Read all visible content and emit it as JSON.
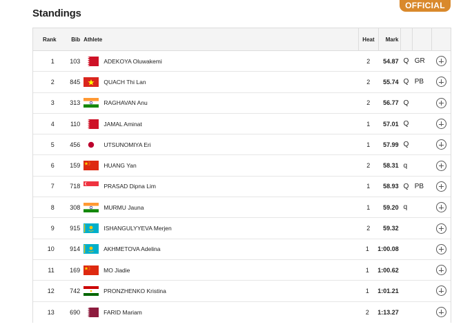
{
  "header": {
    "title": "Standings",
    "badge": "OFFICIAL"
  },
  "columns": {
    "rank": "Rank",
    "bib": "Bib",
    "athlete": "Athlete",
    "heat": "Heat",
    "mark": "Mark"
  },
  "rows": [
    {
      "rank": "1",
      "bib": "103",
      "flag": "bahrain-flag",
      "name": "ADEKOYA Oluwakemi",
      "heat": "2",
      "mark": "54.87",
      "q": "Q",
      "record": "GR"
    },
    {
      "rank": "2",
      "bib": "845",
      "flag": "vietnam-flag",
      "name": "QUACH Thi Lan",
      "heat": "2",
      "mark": "55.74",
      "q": "Q",
      "record": "PB"
    },
    {
      "rank": "3",
      "bib": "313",
      "flag": "india-flag",
      "name": "RAGHAVAN Anu",
      "heat": "2",
      "mark": "56.77",
      "q": "Q",
      "record": ""
    },
    {
      "rank": "4",
      "bib": "110",
      "flag": "bahrain-flag",
      "name": "JAMAL Aminat",
      "heat": "1",
      "mark": "57.01",
      "q": "Q",
      "record": ""
    },
    {
      "rank": "5",
      "bib": "456",
      "flag": "japan-flag",
      "name": "UTSUNOMIYA Eri",
      "heat": "1",
      "mark": "57.99",
      "q": "Q",
      "record": ""
    },
    {
      "rank": "6",
      "bib": "159",
      "flag": "china-flag",
      "name": "HUANG Yan",
      "heat": "2",
      "mark": "58.31",
      "q": "q",
      "record": ""
    },
    {
      "rank": "7",
      "bib": "718",
      "flag": "singapore-flag",
      "name": "PRASAD Dipna Lim",
      "heat": "1",
      "mark": "58.93",
      "q": "Q",
      "record": "PB"
    },
    {
      "rank": "8",
      "bib": "308",
      "flag": "india-flag",
      "name": "MURMU Jauna",
      "heat": "1",
      "mark": "59.20",
      "q": "q",
      "record": ""
    },
    {
      "rank": "9",
      "bib": "915",
      "flag": "kazakhstan-flag",
      "name": "ISHANGULYYEVA Merjen",
      "heat": "2",
      "mark": "59.32",
      "q": "",
      "record": ""
    },
    {
      "rank": "10",
      "bib": "914",
      "flag": "kazakhstan-flag",
      "name": "AKHMETOVA Adelina",
      "heat": "1",
      "mark": "1:00.08",
      "q": "",
      "record": ""
    },
    {
      "rank": "11",
      "bib": "169",
      "flag": "china-flag",
      "name": "MO Jiadie",
      "heat": "1",
      "mark": "1:00.62",
      "q": "",
      "record": ""
    },
    {
      "rank": "12",
      "bib": "742",
      "flag": "tajikistan-flag",
      "name": "PRONZHENKO Kristina",
      "heat": "1",
      "mark": "1:01.21",
      "q": "",
      "record": ""
    },
    {
      "rank": "13",
      "bib": "690",
      "flag": "qatar-flag",
      "name": "FARID Mariam",
      "heat": "2",
      "mark": "1:13.27",
      "q": "",
      "record": ""
    }
  ],
  "colors": {
    "accent": "#d9892c",
    "header_bg": "#f4f4f4",
    "border": "#dcdcdc"
  }
}
